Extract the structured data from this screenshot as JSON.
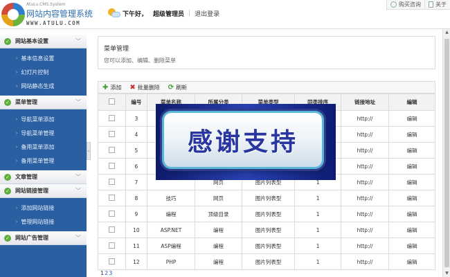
{
  "header": {
    "logo_small": "AtuLu.CMS.System",
    "logo_title": "网站内容管理系统",
    "logo_url": "WWW.ATULU.COM",
    "greeting": "下午好，",
    "user": "超级管理员",
    "separator": "|",
    "logout": "退出登录",
    "top_links": [
      "购买咨询",
      "关于"
    ]
  },
  "sidebar": {
    "groups": [
      {
        "title": "网站基本设置",
        "items": [
          "基本信息设置",
          "幻灯片控制",
          "网站静态生成"
        ]
      },
      {
        "title": "菜单管理",
        "items": [
          "导航菜单添加",
          "导航菜单管理",
          "备用菜单添加",
          "备用菜单管理"
        ]
      },
      {
        "title": "文章管理",
        "items": []
      },
      {
        "title": "网站链接管理",
        "items": [
          "添加网站链接",
          "管理网站链接"
        ]
      },
      {
        "title": "网站广告管理",
        "items": []
      }
    ]
  },
  "panel": {
    "title": "菜单管理",
    "description": "您可以添加、编辑、删除菜单"
  },
  "toolbar": {
    "add": "添加",
    "batch_delete": "批量删除",
    "refresh": "刷新"
  },
  "table": {
    "headers": [
      "",
      "编号",
      "菜单名称",
      "所属分类",
      "菜单类型",
      "同类排序",
      "链接地址",
      "编辑"
    ],
    "rows": [
      [
        "3",
        "",
        "",
        "",
        "",
        "http://",
        "编辑"
      ],
      [
        "4",
        "",
        "",
        "",
        "",
        "http://",
        "编辑"
      ],
      [
        "5",
        "",
        "",
        "",
        "",
        "http://",
        "编辑"
      ],
      [
        "6",
        "",
        "",
        "",
        "",
        "http://",
        "编辑"
      ],
      [
        "7",
        "",
        "网页",
        "图片列表型",
        "1",
        "http://",
        "编辑"
      ],
      [
        "8",
        "技巧",
        "网页",
        "图片列表型",
        "1",
        "http://",
        "编辑"
      ],
      [
        "9",
        "编程",
        "顶级目录",
        "图片列表型",
        "1",
        "http://",
        "编辑"
      ],
      [
        "10",
        "ASP.NET",
        "编程",
        "图片列表型",
        "1",
        "http://",
        "编辑"
      ],
      [
        "11",
        "ASP编程",
        "编程",
        "图片列表型",
        "1",
        "http://",
        "编辑"
      ],
      [
        "12",
        "PHP",
        "编程",
        "图片列表型",
        "1",
        "http://",
        "编辑"
      ]
    ]
  },
  "pager": [
    "1",
    "2",
    "3"
  ],
  "overlay": {
    "text": "感谢支持"
  },
  "colors": {
    "sidebar": "#2a5fa2",
    "link": "#2255cc",
    "ok_icon": "#5fae3b"
  }
}
